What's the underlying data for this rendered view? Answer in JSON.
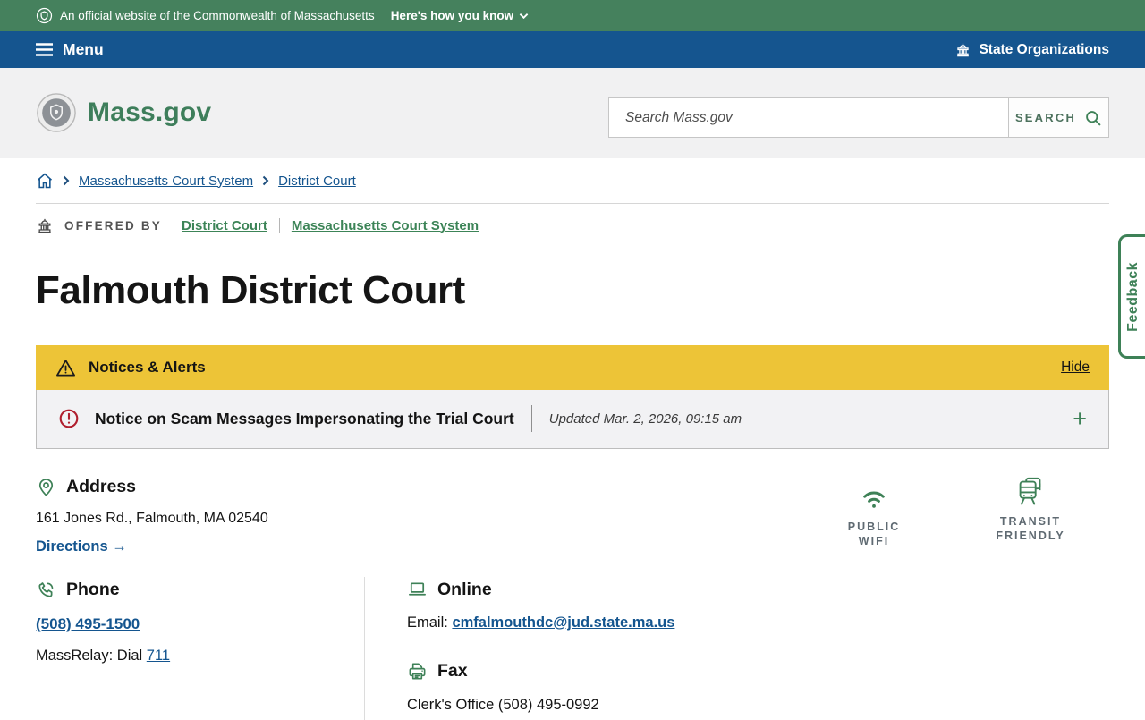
{
  "banner": {
    "official": "An official website of the Commonwealth of Massachusetts",
    "how_know": "Here's how you know"
  },
  "nav": {
    "menu": "Menu",
    "state_orgs": "State Organizations"
  },
  "header": {
    "logo": "Mass.gov",
    "search_placeholder": "Search Mass.gov",
    "search_button": "SEARCH"
  },
  "breadcrumb": {
    "link1": "Massachusetts Court System",
    "link2": "District Court"
  },
  "offered_by": {
    "label": "OFFERED BY",
    "link1": "District Court",
    "link2": "Massachusetts Court System"
  },
  "page_title": "Falmouth District Court",
  "alerts": {
    "title": "Notices & Alerts",
    "hide": "Hide",
    "notice_title": "Notice on Scam Messages Impersonating the Trial Court",
    "updated": "Updated Mar. 2, 2026, 09:15 am",
    "expand_icon": "+"
  },
  "address": {
    "heading": "Address",
    "street": "161 Jones Rd., Falmouth, MA 02540",
    "directions": "Directions",
    "arrow_icon": "→"
  },
  "badges": {
    "wifi": "PUBLIC WIFI",
    "transit": "TRANSIT FRIENDLY"
  },
  "phone": {
    "heading": "Phone",
    "number": "(508) 495-1500",
    "relay_text": "MassRelay: Dial",
    "relay_number": "711"
  },
  "online": {
    "heading": "Online",
    "email_label": "Email:",
    "email": "cmfalmouthdc@jud.state.ma.us"
  },
  "fax": {
    "heading": "Fax",
    "clerk_line": "Clerk's Office (508) 495-0992"
  },
  "feedback": "Feedback",
  "colors": {
    "banner_green": "#45815d",
    "nav_blue": "#15558f",
    "brand_green": "#3e8157",
    "link_blue": "#14558f",
    "alert_yellow": "#edc437",
    "alert_red": "#b01f2e",
    "header_gray": "#f1f1f2",
    "notice_gray": "#f2f2f4"
  }
}
